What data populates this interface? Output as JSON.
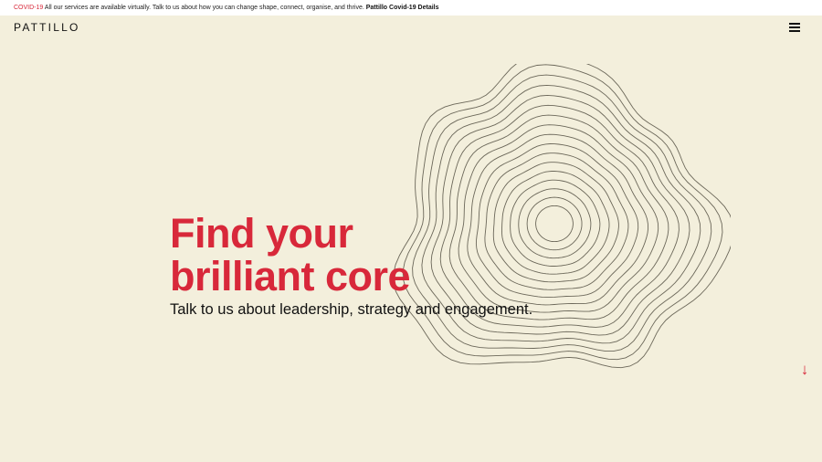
{
  "alert": {
    "tag": "COVID-19",
    "message": " All our services are available virtually. Talk to us about how you can change shape, connect, organise, and thrive. ",
    "link": "Pattillo Covid-19 Details"
  },
  "header": {
    "logo": "PATTILLO",
    "menu_icon": "hamburger-menu-icon"
  },
  "hero": {
    "heading_line1": "Find your",
    "heading_line2": "brilliant core",
    "subheading": "Talk to us about leadership, strategy and engagement."
  },
  "scroll": {
    "icon": "arrow-down-icon",
    "glyph": "↓"
  },
  "colors": {
    "background": "#f3efdc",
    "accent": "#d8283a",
    "text": "#111111"
  }
}
